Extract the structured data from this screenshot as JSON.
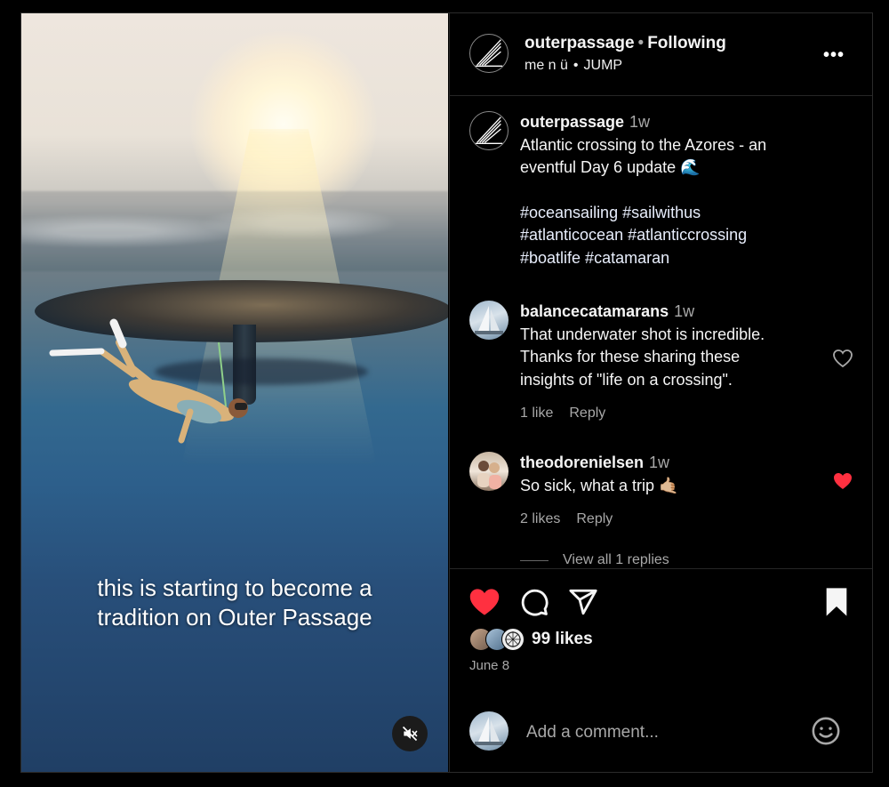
{
  "video": {
    "caption_line1": "this is starting to become a",
    "caption_line2": "tradition on Outer Passage",
    "mute_icon": "speaker-muted-icon"
  },
  "header": {
    "username": "outerpassage",
    "separator": "•",
    "follow_status": "Following",
    "audio_artist": "me n ü",
    "audio_track": "JUMP",
    "more_icon": "more-horizontal-icon"
  },
  "caption": {
    "username": "outerpassage",
    "age": "1w",
    "text_line1": "Atlantic crossing to the Azores - an",
    "text_line2": "eventful Day 6 update 🌊",
    "hashtags_line1": "#oceansailing #sailwithus",
    "hashtags_line2": "#atlanticocean #atlanticcrossing",
    "hashtags_line3": "#boatlife #catamaran"
  },
  "comments": [
    {
      "username": "balancecatamarans",
      "age": "1w",
      "text_line1": "That underwater shot is incredible.",
      "text_line2": "Thanks for these sharing these",
      "text_line3": "insights of \"life on a crossing\".",
      "likes": "1 like",
      "reply": "Reply",
      "liked": false
    },
    {
      "username": "theodorenielsen",
      "age": "1w",
      "text": "So sick, what a trip 🤙🏼",
      "likes": "2 likes",
      "reply": "Reply",
      "liked": true
    }
  ],
  "view_replies": "View all 1 replies",
  "actions": {
    "like_icon": "heart-filled-icon",
    "comment_icon": "comment-icon",
    "share_icon": "send-icon",
    "save_icon": "bookmark-filled-icon",
    "likes_count": "99 likes",
    "date": "June 8"
  },
  "add_comment": {
    "placeholder": "Add a comment...",
    "emoji_icon": "smiley-icon"
  },
  "colors": {
    "like_red": "#ff3040",
    "muted_text": "#a8a8a8",
    "background": "#000000"
  }
}
